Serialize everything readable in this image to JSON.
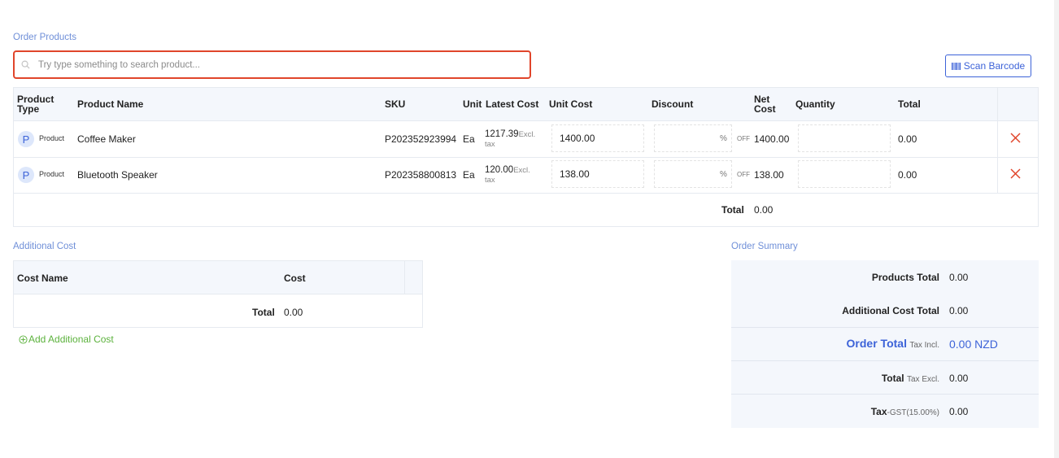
{
  "order_products": {
    "title": "Order Products",
    "search_placeholder": "Try type something to search product...",
    "scan_label": "Scan Barcode",
    "columns": {
      "product_type_1": "Product",
      "product_type_2": "Type",
      "product_name": "Product Name",
      "sku": "SKU",
      "unit": "Unit",
      "latest_cost": "Latest Cost",
      "unit_cost": "Unit Cost",
      "discount": "Discount",
      "net_cost_1": "Net",
      "net_cost_2": "Cost",
      "quantity": "Quantity",
      "total": "Total"
    },
    "rows": [
      {
        "type_badge": "P",
        "type": "Product",
        "name": "Coffee Maker",
        "sku": "P202352923994",
        "unit": "Ea",
        "latest_cost": "1217.39",
        "excl": "Excl.",
        "tax": "tax",
        "unit_cost": "1400.00",
        "discount": "",
        "pct": "%",
        "off": "OFF",
        "net_cost": "1400.00",
        "quantity": "",
        "total": "0.00"
      },
      {
        "type_badge": "P",
        "type": "Product",
        "name": "Bluetooth Speaker",
        "sku": "P202358800813",
        "unit": "Ea",
        "latest_cost": "120.00",
        "excl": "Excl.",
        "tax": "tax",
        "unit_cost": "138.00",
        "discount": "",
        "pct": "%",
        "off": "OFF",
        "net_cost": "138.00",
        "quantity": "",
        "total": "0.00"
      }
    ],
    "footer_label": "Total",
    "footer_value": "0.00"
  },
  "additional_cost": {
    "title": "Additional Cost",
    "columns": {
      "cost_name": "Cost Name",
      "cost": "Cost"
    },
    "footer_label": "Total",
    "footer_value": "0.00",
    "add_label": "Add Additional Cost"
  },
  "order_summary": {
    "title": "Order Summary",
    "products_total_label": "Products Total",
    "products_total_value": "0.00",
    "additional_cost_total_label": "Additional Cost Total",
    "additional_cost_total_value": "0.00",
    "order_total_label": "Order Total",
    "order_total_sub": "Tax Incl.",
    "order_total_value": "0.00 NZD",
    "total_label": "Total",
    "total_sub": "Tax Excl.",
    "total_value": "0.00",
    "tax_label": "Tax",
    "tax_sub": "-GST(15.00%)",
    "tax_value": "0.00"
  },
  "colors": {
    "accent": "#3d63d8",
    "search_border": "#e0452b",
    "delete": "#e0452b",
    "add_link": "#5cb23d",
    "section_title": "#6f8fd8"
  },
  "icons": [
    "search-icon",
    "barcode-icon",
    "close-icon",
    "plus-circle-icon"
  ]
}
